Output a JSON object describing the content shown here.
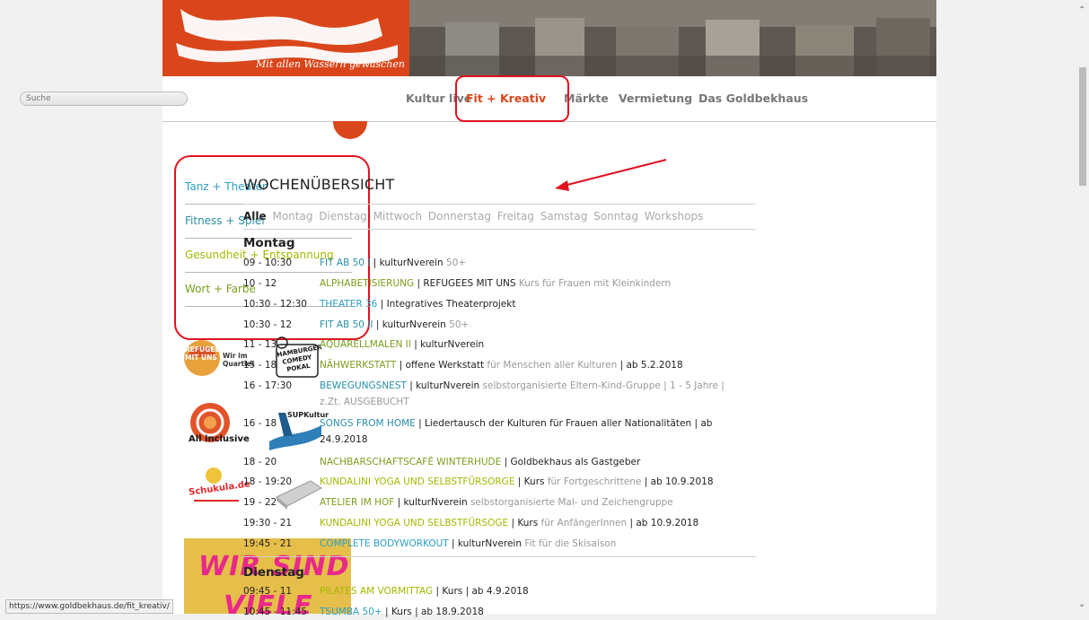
{
  "banner": {
    "tagline": "Mit allen Wassern gewaschen"
  },
  "search": {
    "placeholder": "Suche"
  },
  "nav": {
    "items": [
      {
        "label": "Kultur live"
      },
      {
        "label": "Fit + Kreativ"
      },
      {
        "label": "Märkte"
      },
      {
        "label": "Vermietung"
      },
      {
        "label": "Das Goldbekhaus"
      }
    ]
  },
  "sidebar": {
    "items": [
      {
        "label": "Tanz + Theater"
      },
      {
        "label": "Fitness + Spiel"
      },
      {
        "label": "Gesundheit + Entspannung"
      },
      {
        "label": "Wort + Farbe"
      }
    ]
  },
  "logos": {
    "refugees": "REFUGEES MIT UNS",
    "wir_im_quartier": "Wir im Quartier",
    "comedy": "HAMBURGER COMEDY POKAL",
    "all_inclusive": "All inclusive",
    "supkultur": "SUPKultur",
    "schukula": "Schukula.de",
    "banner_line1": "WIR SIND",
    "banner_line2": "VIELE"
  },
  "main": {
    "heading": "WOCHENÜBERSICHT",
    "filters": [
      "Alle",
      "Montag",
      "Dienstag",
      "Mittwoch",
      "Donnerstag",
      "Freitag",
      "Samstag",
      "Sonntag",
      "Workshops"
    ],
    "days": [
      {
        "name": "Montag",
        "events": [
          {
            "time": "09 - 10:30",
            "title": "FIT AB 50 I",
            "sep": " | ",
            "org": "kulturNverein",
            "rest": " 50+"
          },
          {
            "time": "10 - 12",
            "title": "ALPHABETISIERUNG",
            "sep": " | ",
            "org": "REFUGEES MIT UNS",
            "rest": " Kurs für Frauen mit Kleinkindern"
          },
          {
            "time": "10:30 - 12:30",
            "title": "THEATER 36",
            "sep": " | ",
            "org": "Integratives Theaterprojekt",
            "rest": ""
          },
          {
            "time": "10:30 - 12",
            "title": "FIT AB 50 II",
            "sep": " | ",
            "org": "kulturNverein",
            "rest": " 50+"
          },
          {
            "time": "11 - 13",
            "title": "AQUARELLMALEN II",
            "sep": " | ",
            "org": "kulturNverein",
            "rest": ""
          },
          {
            "time": "15 - 18",
            "title": "NÄHWERKSTATT",
            "sep": " | ",
            "org": "offene Werkstatt",
            "rest": " für Menschen aller Kulturen",
            "tail": " | ab 5.2.2018"
          },
          {
            "time": "16 - 17:30",
            "title": "BEWEGUNGSNEST",
            "sep": " | ",
            "org": "kulturNverein",
            "rest": " selbstorganisierte Eltern-Kind-Gruppe | 1 - 5 Jahre | z.Zt. AUSGEBUCHT"
          },
          {
            "time": "16 - 18",
            "title": "SONGS FROM HOME",
            "sep": " | ",
            "org": "Liedertausch der Kulturen für Frauen aller Nationalitäten | ab 24.9.2018",
            "rest": ""
          },
          {
            "time": "18 - 20",
            "title": "NACHBARSCHAFTSCAFÉ WINTERHUDE",
            "sep": " | ",
            "org": "Goldbekhaus als Gastgeber",
            "rest": ""
          },
          {
            "time": "18 - 19:20",
            "title": "KUNDALINI YOGA UND SELBSTFÜRSORGE",
            "sep": " | ",
            "org": "Kurs",
            "rest": " für Fortgeschrittene",
            "tail": " | ab 10.9.2018"
          },
          {
            "time": "19 - 22",
            "title": "ATELIER IM HOF",
            "sep": " | ",
            "org": "kulturNverein",
            "rest": " selbstorganisierte Mal- und Zeichengruppe"
          },
          {
            "time": "19:30 - 21",
            "title": "KUNDALINI YOGA UND SELBSTFÜRSOGE",
            "sep": " | ",
            "org": "Kurs",
            "rest": " für AnfängerInnen",
            "tail": " | ab 10.9.2018"
          },
          {
            "time": "19:45 - 21",
            "title": "COMPLETE BODYWORKOUT",
            "sep": " | ",
            "org": "kulturNverein",
            "rest": " Fit für die Skisaison"
          }
        ]
      },
      {
        "name": "Dienstag",
        "events": [
          {
            "time": "09:45 - 11",
            "title": "PILATES AM VORMITTAG",
            "sep": " | ",
            "org": "Kurs | ab 4.9.2018",
            "rest": ""
          },
          {
            "time": "10:45 - 11:45",
            "title": "TSUMBA 50+",
            "sep": " | ",
            "org": "Kurs | ab 18.9.2018",
            "rest": ""
          }
        ]
      }
    ]
  },
  "status_bar": {
    "url": "https://www.goldbekhaus.de/fit_kreativ/"
  },
  "colors": {
    "brand": "#d9461b",
    "annotation": "#e0121f",
    "green": "#7a9e1c",
    "teal": "#2a8fa8",
    "lime": "#a4b800"
  }
}
